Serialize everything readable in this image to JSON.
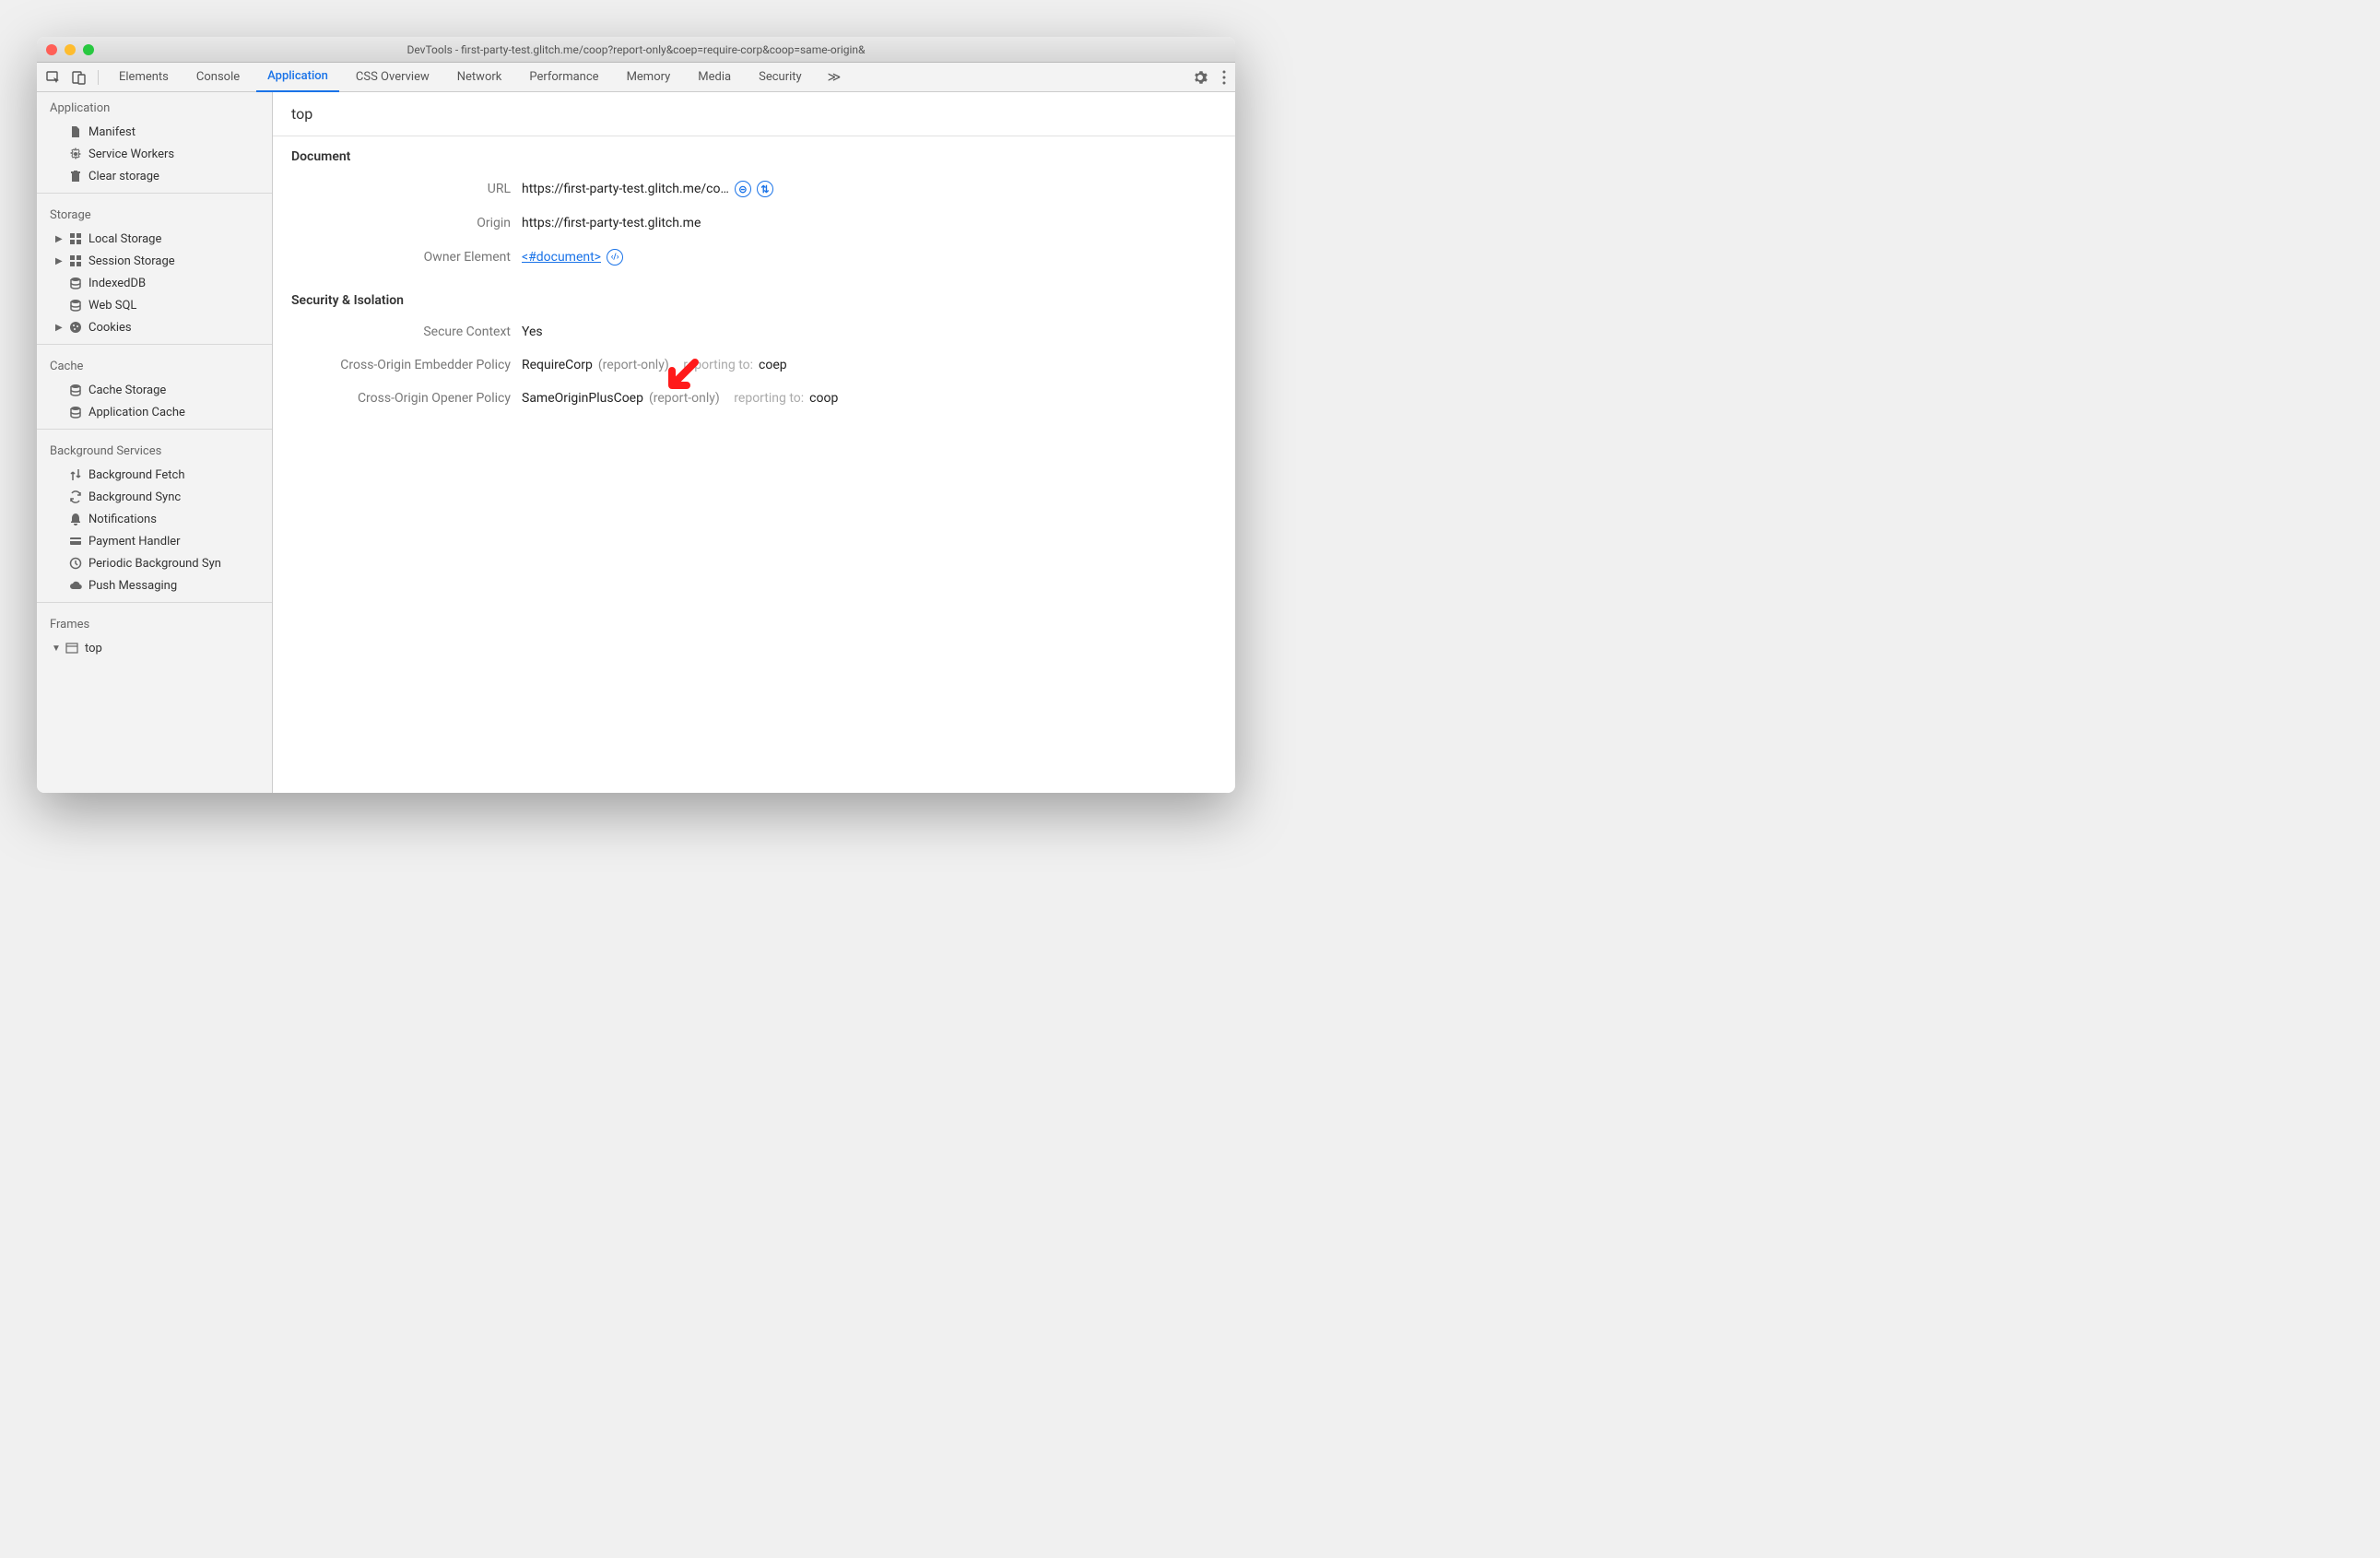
{
  "window": {
    "title": "DevTools - first-party-test.glitch.me/coop?report-only&coep=require-corp&coop=same-origin&"
  },
  "toolbar": {
    "tabs": [
      "Elements",
      "Console",
      "Application",
      "CSS Overview",
      "Network",
      "Performance",
      "Memory",
      "Media",
      "Security"
    ],
    "active_index": 2,
    "more": "≫"
  },
  "sidebar": {
    "groups": [
      {
        "title": "Application",
        "items": [
          {
            "label": "Manifest",
            "icon": "file"
          },
          {
            "label": "Service Workers",
            "icon": "gear"
          },
          {
            "label": "Clear storage",
            "icon": "trash"
          }
        ]
      },
      {
        "title": "Storage",
        "items": [
          {
            "label": "Local Storage",
            "icon": "grid",
            "caret": true
          },
          {
            "label": "Session Storage",
            "icon": "grid",
            "caret": true
          },
          {
            "label": "IndexedDB",
            "icon": "db"
          },
          {
            "label": "Web SQL",
            "icon": "db"
          },
          {
            "label": "Cookies",
            "icon": "cookie",
            "caret": true
          }
        ]
      },
      {
        "title": "Cache",
        "items": [
          {
            "label": "Cache Storage",
            "icon": "db"
          },
          {
            "label": "Application Cache",
            "icon": "db"
          }
        ]
      },
      {
        "title": "Background Services",
        "items": [
          {
            "label": "Background Fetch",
            "icon": "updown"
          },
          {
            "label": "Background Sync",
            "icon": "sync"
          },
          {
            "label": "Notifications",
            "icon": "bell"
          },
          {
            "label": "Payment Handler",
            "icon": "card"
          },
          {
            "label": "Periodic Background Syn",
            "icon": "clock"
          },
          {
            "label": "Push Messaging",
            "icon": "cloud"
          }
        ]
      },
      {
        "title": "Frames",
        "items": [
          {
            "label": "top",
            "icon": "window",
            "caret": true,
            "selected": true
          }
        ]
      }
    ]
  },
  "main": {
    "header": "top",
    "sections": [
      {
        "title": "Document",
        "rows": [
          {
            "label": "URL",
            "value": "https://first-party-test.glitch.me/co…",
            "badges": [
              "iso",
              "swap"
            ]
          },
          {
            "label": "Origin",
            "value": "https://first-party-test.glitch.me"
          },
          {
            "label": "Owner Element",
            "link": "<#document>",
            "badges": [
              "code"
            ]
          }
        ]
      },
      {
        "title": "Security & Isolation",
        "rows": [
          {
            "label": "Secure Context",
            "value": "Yes"
          },
          {
            "label": "Cross-Origin Embedder Policy",
            "parts": [
              {
                "text": "RequireCorp"
              },
              {
                "text": "(report-only)",
                "cls": "gray"
              },
              {
                "text": "reporting to:",
                "cls": "light"
              },
              {
                "text": "coep"
              }
            ]
          },
          {
            "label": "Cross-Origin Opener Policy",
            "parts": [
              {
                "text": "SameOriginPlusCoep"
              },
              {
                "text": "(report-only)",
                "cls": "gray"
              },
              {
                "text": "reporting to:",
                "cls": "light"
              },
              {
                "text": "coop"
              }
            ]
          }
        ]
      }
    ]
  }
}
